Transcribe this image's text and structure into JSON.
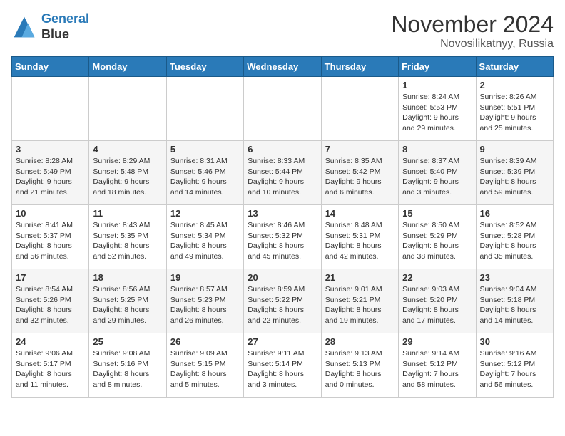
{
  "header": {
    "logo_line1": "General",
    "logo_line2": "Blue",
    "month": "November 2024",
    "location": "Novosilikatnyy, Russia"
  },
  "weekdays": [
    "Sunday",
    "Monday",
    "Tuesday",
    "Wednesday",
    "Thursday",
    "Friday",
    "Saturday"
  ],
  "weeks": [
    [
      {
        "day": "",
        "info": ""
      },
      {
        "day": "",
        "info": ""
      },
      {
        "day": "",
        "info": ""
      },
      {
        "day": "",
        "info": ""
      },
      {
        "day": "",
        "info": ""
      },
      {
        "day": "1",
        "info": "Sunrise: 8:24 AM\nSunset: 5:53 PM\nDaylight: 9 hours\nand 29 minutes."
      },
      {
        "day": "2",
        "info": "Sunrise: 8:26 AM\nSunset: 5:51 PM\nDaylight: 9 hours\nand 25 minutes."
      }
    ],
    [
      {
        "day": "3",
        "info": "Sunrise: 8:28 AM\nSunset: 5:49 PM\nDaylight: 9 hours\nand 21 minutes."
      },
      {
        "day": "4",
        "info": "Sunrise: 8:29 AM\nSunset: 5:48 PM\nDaylight: 9 hours\nand 18 minutes."
      },
      {
        "day": "5",
        "info": "Sunrise: 8:31 AM\nSunset: 5:46 PM\nDaylight: 9 hours\nand 14 minutes."
      },
      {
        "day": "6",
        "info": "Sunrise: 8:33 AM\nSunset: 5:44 PM\nDaylight: 9 hours\nand 10 minutes."
      },
      {
        "day": "7",
        "info": "Sunrise: 8:35 AM\nSunset: 5:42 PM\nDaylight: 9 hours\nand 6 minutes."
      },
      {
        "day": "8",
        "info": "Sunrise: 8:37 AM\nSunset: 5:40 PM\nDaylight: 9 hours\nand 3 minutes."
      },
      {
        "day": "9",
        "info": "Sunrise: 8:39 AM\nSunset: 5:39 PM\nDaylight: 8 hours\nand 59 minutes."
      }
    ],
    [
      {
        "day": "10",
        "info": "Sunrise: 8:41 AM\nSunset: 5:37 PM\nDaylight: 8 hours\nand 56 minutes."
      },
      {
        "day": "11",
        "info": "Sunrise: 8:43 AM\nSunset: 5:35 PM\nDaylight: 8 hours\nand 52 minutes."
      },
      {
        "day": "12",
        "info": "Sunrise: 8:45 AM\nSunset: 5:34 PM\nDaylight: 8 hours\nand 49 minutes."
      },
      {
        "day": "13",
        "info": "Sunrise: 8:46 AM\nSunset: 5:32 PM\nDaylight: 8 hours\nand 45 minutes."
      },
      {
        "day": "14",
        "info": "Sunrise: 8:48 AM\nSunset: 5:31 PM\nDaylight: 8 hours\nand 42 minutes."
      },
      {
        "day": "15",
        "info": "Sunrise: 8:50 AM\nSunset: 5:29 PM\nDaylight: 8 hours\nand 38 minutes."
      },
      {
        "day": "16",
        "info": "Sunrise: 8:52 AM\nSunset: 5:28 PM\nDaylight: 8 hours\nand 35 minutes."
      }
    ],
    [
      {
        "day": "17",
        "info": "Sunrise: 8:54 AM\nSunset: 5:26 PM\nDaylight: 8 hours\nand 32 minutes."
      },
      {
        "day": "18",
        "info": "Sunrise: 8:56 AM\nSunset: 5:25 PM\nDaylight: 8 hours\nand 29 minutes."
      },
      {
        "day": "19",
        "info": "Sunrise: 8:57 AM\nSunset: 5:23 PM\nDaylight: 8 hours\nand 26 minutes."
      },
      {
        "day": "20",
        "info": "Sunrise: 8:59 AM\nSunset: 5:22 PM\nDaylight: 8 hours\nand 22 minutes."
      },
      {
        "day": "21",
        "info": "Sunrise: 9:01 AM\nSunset: 5:21 PM\nDaylight: 8 hours\nand 19 minutes."
      },
      {
        "day": "22",
        "info": "Sunrise: 9:03 AM\nSunset: 5:20 PM\nDaylight: 8 hours\nand 17 minutes."
      },
      {
        "day": "23",
        "info": "Sunrise: 9:04 AM\nSunset: 5:18 PM\nDaylight: 8 hours\nand 14 minutes."
      }
    ],
    [
      {
        "day": "24",
        "info": "Sunrise: 9:06 AM\nSunset: 5:17 PM\nDaylight: 8 hours\nand 11 minutes."
      },
      {
        "day": "25",
        "info": "Sunrise: 9:08 AM\nSunset: 5:16 PM\nDaylight: 8 hours\nand 8 minutes."
      },
      {
        "day": "26",
        "info": "Sunrise: 9:09 AM\nSunset: 5:15 PM\nDaylight: 8 hours\nand 5 minutes."
      },
      {
        "day": "27",
        "info": "Sunrise: 9:11 AM\nSunset: 5:14 PM\nDaylight: 8 hours\nand 3 minutes."
      },
      {
        "day": "28",
        "info": "Sunrise: 9:13 AM\nSunset: 5:13 PM\nDaylight: 8 hours\nand 0 minutes."
      },
      {
        "day": "29",
        "info": "Sunrise: 9:14 AM\nSunset: 5:12 PM\nDaylight: 7 hours\nand 58 minutes."
      },
      {
        "day": "30",
        "info": "Sunrise: 9:16 AM\nSunset: 5:12 PM\nDaylight: 7 hours\nand 56 minutes."
      }
    ]
  ]
}
